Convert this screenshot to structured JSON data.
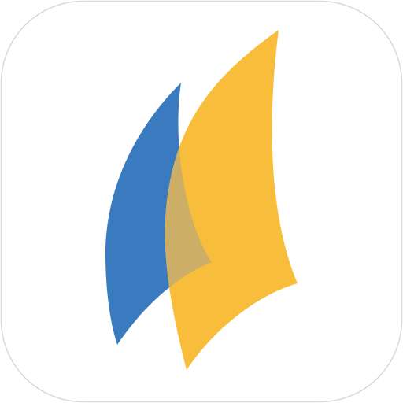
{
  "icon": {
    "name": "sails-app-icon",
    "colors": {
      "background": "#ffffff",
      "border": "#d9d9d9",
      "sail_back": "#3a7bbf",
      "sail_front": "#f8bd3b",
      "overlap": "#cdae66"
    }
  }
}
